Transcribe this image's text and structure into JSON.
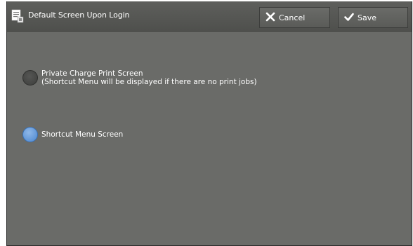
{
  "window": {
    "title": "Default Screen Upon Login",
    "title_icon": "document-settings-icon"
  },
  "buttons": {
    "cancel_label": "Cancel",
    "cancel_icon": "x-icon",
    "save_label": "Save",
    "save_icon": "checkmark-icon"
  },
  "options": [
    {
      "line1": "Private Charge Print Screen",
      "line2": "(Shortcut Menu will be displayed if there are no print jobs)",
      "selected": false
    },
    {
      "line1": "Shortcut Menu Screen",
      "selected": true
    }
  ],
  "colors": {
    "background": "#6a6b68",
    "titlebar": "#555653",
    "selected_radio": "#4b86d0",
    "unselected_radio": "#454644",
    "text": "#ffffff"
  }
}
